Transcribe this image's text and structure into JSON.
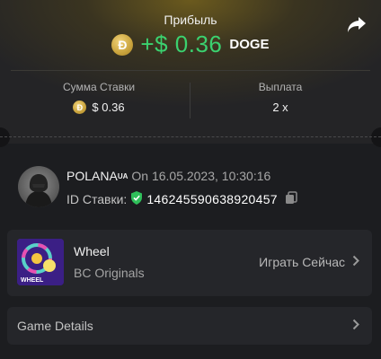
{
  "header": {
    "profit_title": "Прибыль",
    "profit_amount": "+$ 0.36",
    "currency": "DOGE",
    "coin_letter": "Ð"
  },
  "stats": {
    "bet_amount_label": "Сумма Ставки",
    "bet_amount_value": "$ 0.36",
    "payout_label": "Выплата",
    "payout_value": "2 x"
  },
  "user": {
    "name": "POLANA",
    "flag": "UA",
    "date_text": "On 16.05.2023, 10:30:16",
    "bet_id_label": "ID Ставки:",
    "bet_id": "146245590638920457"
  },
  "game": {
    "name": "Wheel",
    "provider": "BC Originals",
    "play_label": "Играть Сейчас",
    "thumb_text": "WHEEL"
  },
  "details": {
    "label": "Game Details"
  },
  "colors": {
    "profit_green": "#3bd16f",
    "coin_gold": "#c9a33c",
    "shield_green": "#2fbf5a"
  }
}
